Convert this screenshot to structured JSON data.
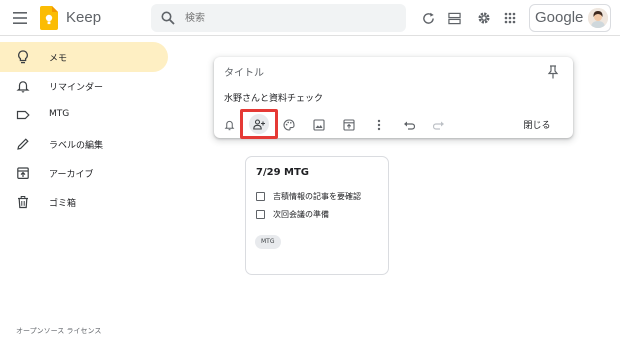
{
  "header": {
    "app_title": "Keep",
    "search_placeholder": "検索",
    "brand": "Google"
  },
  "sidebar": {
    "items": [
      {
        "label": "メモ",
        "icon": "lightbulb-icon",
        "active": true
      },
      {
        "label": "リマインダー",
        "icon": "bell-icon",
        "active": false
      },
      {
        "label": "MTG",
        "icon": "label-icon",
        "active": false
      },
      {
        "label": "ラベルの編集",
        "icon": "pencil-icon",
        "active": false
      },
      {
        "label": "アーカイブ",
        "icon": "archive-icon",
        "active": false
      },
      {
        "label": "ゴミ箱",
        "icon": "trash-icon",
        "active": false
      }
    ],
    "footer": "オープンソース ライセンス"
  },
  "editor": {
    "title_placeholder": "タイトル",
    "body": "水野さんと資料チェック",
    "close_label": "閉じる",
    "toolbar_icons": [
      "remind-icon",
      "collaborator-icon",
      "palette-icon",
      "image-icon",
      "archive-icon",
      "more-icon",
      "undo-icon",
      "redo-icon"
    ]
  },
  "card": {
    "title": "7/29 MTG",
    "items": [
      {
        "text": "吉積情報の記事を要確認",
        "checked": false
      },
      {
        "text": "次回会議の準備",
        "checked": false
      }
    ],
    "label": "MTG"
  },
  "colors": {
    "active_nav": "#feefc3",
    "highlight": "#e53935",
    "logo": "#fbbc04"
  }
}
